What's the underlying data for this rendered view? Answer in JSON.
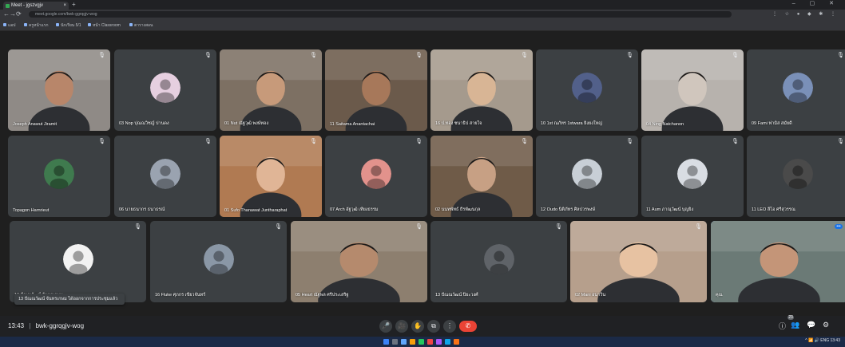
{
  "browser": {
    "tab_title": "Meet - jgszvgjv",
    "tab_close": "×",
    "new_tab": "+",
    "window_controls": "– ▢ ✕",
    "url": "meet.google.com/bwk-ggrqgjv-wog",
    "nav": [
      "←",
      "→",
      "⟳",
      "⌂"
    ],
    "extensions": "⋮ ☆ ● ◆ ✱ ⋮",
    "bookmarks": [
      "แอป",
      "ครูหน้าแรก",
      "นักเรียน 5/1",
      "หน้า Classroom",
      "ตารางสอน"
    ]
  },
  "participants": [
    {
      "name": "Joseph Anawut Jiramit",
      "mic": "muted",
      "mode": "video",
      "bg": "#8f8a86",
      "skin": "#b8866a"
    },
    {
      "name": "03 Nop ปุณณวิชญ์ ปานดง",
      "mic": "muted",
      "mode": "avatar",
      "color": "#e6cfe0"
    },
    {
      "name": "01 Nut ณัฐวุฒิ พงษ์ทอง",
      "mic": "muted",
      "mode": "video",
      "bg": "#7d7063",
      "skin": "#c79a7a"
    },
    {
      "name": "11 Saitama Anantachai",
      "mic": "muted",
      "mode": "video",
      "bg": "#6b5a4b",
      "skin": "#a7785a"
    },
    {
      "name": "16 ป.ทอง ชนาธิป สายใจ",
      "mic": "muted",
      "mode": "video",
      "bg": "#a59a8d",
      "skin": "#d8b595"
    },
    {
      "name": "10 1st ณภัทร 1stwara ยิ่งยงใหญ่",
      "mic": "muted",
      "mode": "avatar",
      "color": "#52608a"
    },
    {
      "name": "04 Ning Natchanon",
      "mic": "muted",
      "mode": "video",
      "bg": "#b7b2ad",
      "skin": "#d0c6bd"
    },
    {
      "name": "09 Fami ฟามิส สมัยดี",
      "mic": "muted",
      "mode": "avatar",
      "color": "#7a90b8"
    },
    {
      "name": "Topagon Harnrieut",
      "mic": "muted",
      "mode": "avatar",
      "color": "#3f7a4e"
    },
    {
      "name": "06 นายธนากร ธนาธรณ์",
      "mic": "muted",
      "mode": "avatar",
      "color": "#9aa3b0"
    },
    {
      "name": "01 Sufo Thanawat Juntharaphat",
      "mic": "muted",
      "mode": "video",
      "bg": "#b07a52",
      "skin": "#e0b596"
    },
    {
      "name": "07 Arch อัฐวุฒิ เที่ยงธรรม",
      "mic": "muted",
      "mode": "avatar",
      "color": "#e2928c"
    },
    {
      "name": "02 นนทพัทธ์ ธีรพัฒนกุล",
      "mic": "muted",
      "mode": "video",
      "bg": "#6f5b48",
      "skin": "#c7a084"
    },
    {
      "name": "12 Oudo นิติภัทร ศิลปวรพงษ์",
      "mic": "muted",
      "mode": "avatar",
      "color": "#c8cfd6"
    },
    {
      "name": "11 Aum ภาณุวัฒน์ บุญยิ่ง",
      "mic": "muted",
      "mode": "avatar",
      "color": "#d9dde3"
    },
    {
      "name": "11 LEO ลีโอ ศรีสุวรรณ",
      "mic": "muted",
      "mode": "avatar",
      "color": "#4a4a4a"
    },
    {
      "name": "13 ปัณณวัฒน์ จันทรเกษม",
      "mic": "muted",
      "mode": "avatar",
      "color": "#f2f2f2"
    },
    {
      "name": "16 Fluke ศุภกร เขียวจันทร์",
      "mic": "muted",
      "mode": "avatar",
      "color": "#8a97a6"
    },
    {
      "name": "05 Heart ณัฐพล ศรีประเสริฐ",
      "mic": "muted",
      "mode": "video",
      "bg": "#8d7f6f",
      "skin": "#b58a6d"
    },
    {
      "name": "13 ปัณณวัฒน์ ปิยะวงศ์",
      "mic": "muted",
      "mode": "avatar",
      "color": "#5f6368"
    },
    {
      "name": "02 Mani อนาวิน",
      "mic": "muted",
      "mode": "video",
      "bg": "#b69f8c",
      "skin": "#e7c2a2"
    },
    {
      "name": "คุณ",
      "mic": "active",
      "mode": "video",
      "bg": "#6b7a76",
      "skin": "#c49578"
    }
  ],
  "tooltip": "13 ปัณณวัฒน์ จันทรเกษม ได้ออกจากการประชุมแล้ว",
  "bottom_bar": {
    "time": "13:43",
    "separator": "|",
    "meeting_code": "bwk-ggrqgjv-wog",
    "controls": [
      "🎤",
      "🎥",
      "✋",
      "⧉",
      "⋮"
    ],
    "end_call": "✆",
    "right_controls": [
      "ⓘ",
      "👥",
      "💬",
      "⚙"
    ],
    "participant_count": "23"
  },
  "taskbar": {
    "tray": "^ 📶 🔊 ENG 13:43",
    "icons": [
      "#3b82f6",
      "#6b7280",
      "#60a5fa",
      "#f59e0b",
      "#22c55e",
      "#ef4444",
      "#a855f7",
      "#0ea5e9",
      "#f97316"
    ]
  }
}
